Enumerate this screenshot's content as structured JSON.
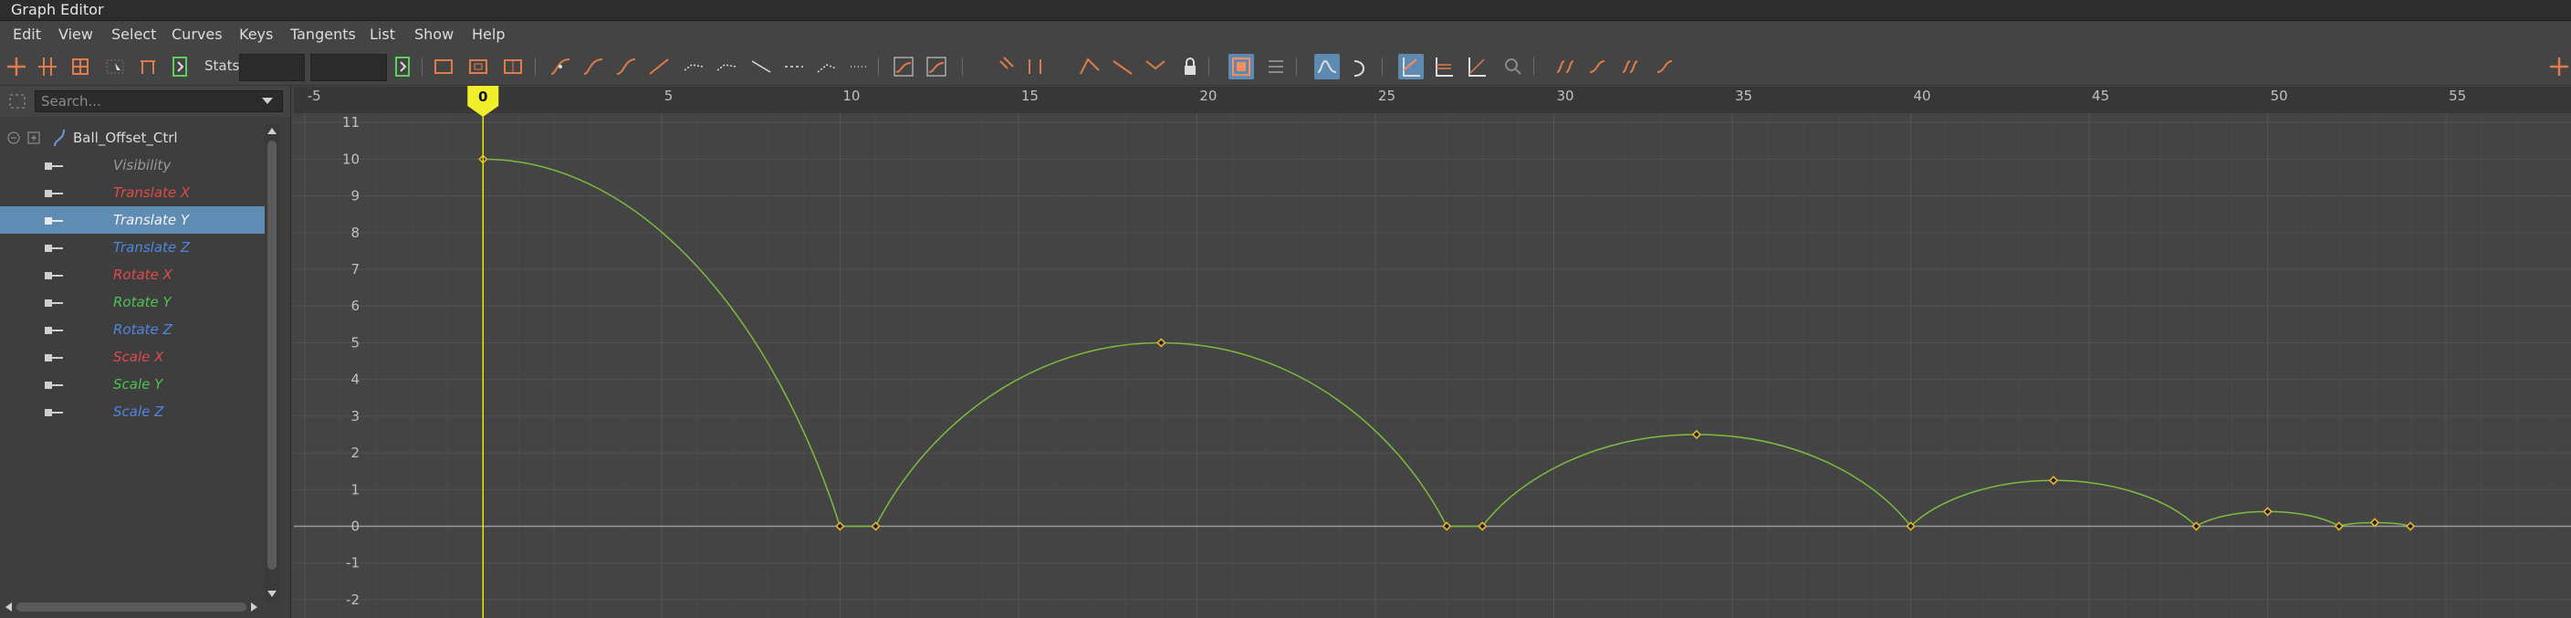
{
  "window": {
    "title": "Graph Editor"
  },
  "menu": [
    "Edit",
    "View",
    "Select",
    "Curves",
    "Keys",
    "Tangents",
    "List",
    "Show",
    "Help"
  ],
  "toolbar": {
    "stats_label": "Stats"
  },
  "outliner": {
    "search_placeholder": "Search...",
    "object": "Ball_Offset_Ctrl",
    "channels": [
      {
        "label": "Visibility",
        "color": "#9a9a9a",
        "selected": false
      },
      {
        "label": "Translate X",
        "color": "#e04a4a",
        "selected": false
      },
      {
        "label": "Translate Y",
        "color": "#f2f2f2",
        "selected": true
      },
      {
        "label": "Translate Z",
        "color": "#4f86e0",
        "selected": false
      },
      {
        "label": "Rotate X",
        "color": "#e04a4a",
        "selected": false
      },
      {
        "label": "Rotate Y",
        "color": "#4ec24e",
        "selected": false
      },
      {
        "label": "Rotate Z",
        "color": "#4f86e0",
        "selected": false
      },
      {
        "label": "Scale X",
        "color": "#e04a4a",
        "selected": false
      },
      {
        "label": "Scale Y",
        "color": "#4ec24e",
        "selected": false
      },
      {
        "label": "Scale Z",
        "color": "#4f86e0",
        "selected": false
      }
    ]
  },
  "timeline": {
    "current_frame": "0",
    "frame_ticks": [
      "-5",
      "0",
      "5",
      "10",
      "15",
      "20",
      "25",
      "30",
      "35",
      "40",
      "45",
      "50",
      "55"
    ],
    "value_ticks": [
      "11",
      "10",
      "9",
      "8",
      "7",
      "6",
      "5",
      "4",
      "3",
      "2",
      "1",
      "0",
      "-1",
      "-2"
    ]
  },
  "chart_data": {
    "type": "line",
    "title": "",
    "xlabel": "",
    "ylabel": "",
    "xlim": [
      -5.3,
      58.5
    ],
    "ylim": [
      -2.5,
      12.0
    ],
    "series": [
      {
        "name": "Translate Y",
        "color": "#7bbd3e",
        "keys": [
          {
            "frame": 0,
            "value": 10
          },
          {
            "frame": 10,
            "value": 0
          },
          {
            "frame": 11,
            "value": 0
          },
          {
            "frame": 19,
            "value": 5
          },
          {
            "frame": 27,
            "value": 0
          },
          {
            "frame": 28,
            "value": 0
          },
          {
            "frame": 34,
            "value": 2.5
          },
          {
            "frame": 40,
            "value": 0
          },
          {
            "frame": 44,
            "value": 1.25
          },
          {
            "frame": 48,
            "value": 0
          },
          {
            "frame": 50,
            "value": 0.4
          },
          {
            "frame": 52,
            "value": 0
          },
          {
            "frame": 53,
            "value": 0.1
          },
          {
            "frame": 54,
            "value": 0
          }
        ]
      }
    ]
  }
}
